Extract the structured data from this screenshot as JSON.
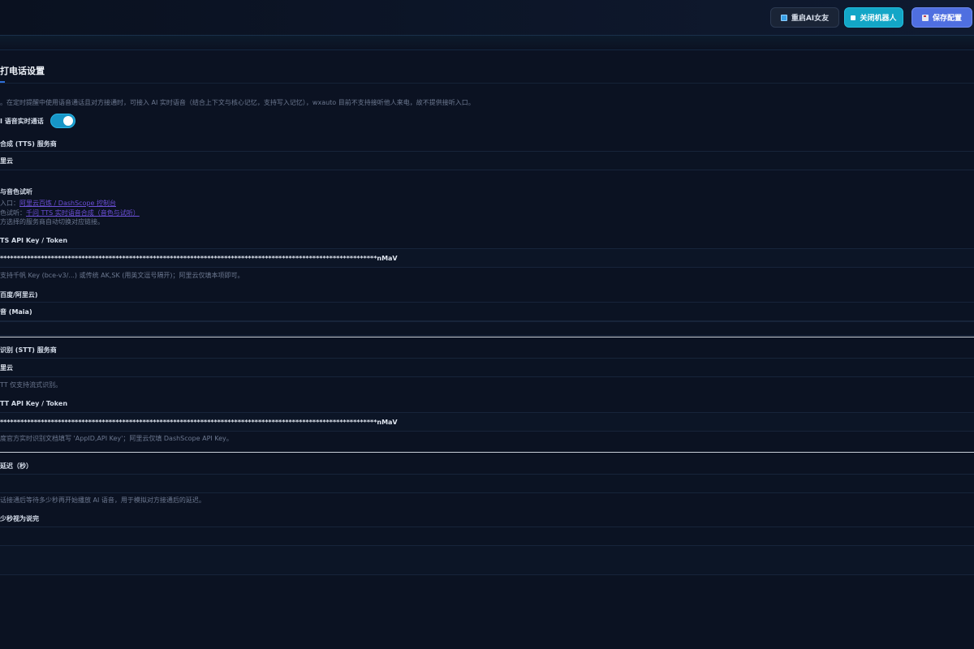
{
  "toolbar": {
    "restart_label": "重启AI女友",
    "close_label": "关闭机器人",
    "save_label": "保存配置"
  },
  "section": {
    "title": "打电话设置",
    "description": "。在定时提醒中使用语音通话且对方接通时，可接入 AI 实时语音（结合上下文与核心记忆，支持写入记忆），wxauto 目前不支持接听他人来电，故不提供接听入口。",
    "toggle_label": "I 语音实时通话",
    "toggle_on": true
  },
  "tts": {
    "provider_label": "合成 (TTS) 服务商",
    "provider_value": "里云",
    "voice_section_label": "与音色试听",
    "entry_prefix": "入口：",
    "entry_link": "阿里云百炼 / DashScope 控制台",
    "audition_prefix": "色试听：",
    "audition_link": "千问 TTS 实时语音合成（音色与试听）",
    "entry_note": "方选择的服务商自动切换对应链接。",
    "api_key_label": "TS API Key / Token",
    "api_key_value": "***************************************************************************************************************nMaV",
    "api_key_hint": "支持千帆 Key (bce-v3/...) 或传统 AK,SK (用英文逗号隔开)；阿里云仅填本项即可。",
    "voice_label": "百度/阿里云)",
    "voice_value": "音 (Maia)"
  },
  "stt": {
    "provider_label": "识别 (STT) 服务商",
    "provider_value": "里云",
    "provider_hint": "TT 仅支持流式识别。",
    "api_key_label": "TT API Key / Token",
    "api_key_value": "***************************************************************************************************************nMaV",
    "api_key_hint": "度官方实时识别文档填写 'AppID,API Key'；阿里云仅填 DashScope API Key。"
  },
  "delay": {
    "label": "延迟（秒）",
    "value": "",
    "hint": "话接通后等待多少秒再开始播放 AI 语音，用于模拟对方接通后的延迟。",
    "silence_label": "少秒视为说完",
    "silence_value": ""
  }
}
